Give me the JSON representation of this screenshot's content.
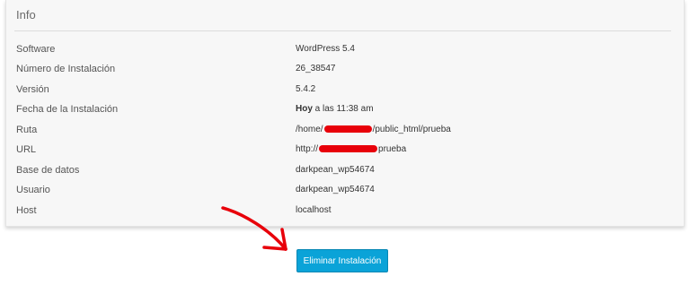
{
  "panel": {
    "title": "Info"
  },
  "info": [
    {
      "label": "Software",
      "value": "WordPress 5.4"
    },
    {
      "label": "Número de Instalación",
      "value": "26_38547"
    },
    {
      "label": "Versión",
      "value": "5.4.2"
    },
    {
      "label": "Fecha de la Instalación",
      "value_bold": "Hoy",
      "value_rest": " a las 11:38 am"
    },
    {
      "label": "Ruta",
      "value_prefix": "/home/",
      "value_suffix": "/public_html/prueba"
    },
    {
      "label": "URL",
      "value_prefix": "http://",
      "value_suffix": "prueba"
    },
    {
      "label": "Base de datos",
      "value": "darkpean_wp54674"
    },
    {
      "label": "Usuario",
      "value": "darkpean_wp54674"
    },
    {
      "label": "Host",
      "value": "localhost"
    }
  ],
  "actions": {
    "delete_label": "Eliminar Instalación"
  },
  "colors": {
    "button": "#0aa3d8",
    "annotation_arrow": "#e8000a",
    "redaction": "#e8000a"
  }
}
